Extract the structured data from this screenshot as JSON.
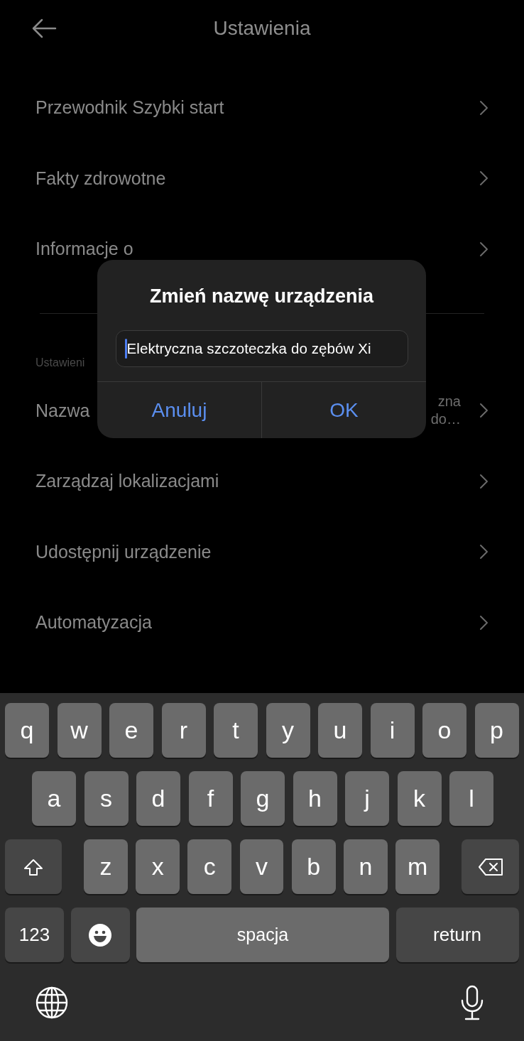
{
  "header": {
    "title": "Ustawienia"
  },
  "sections": [
    {
      "items": [
        {
          "label": "Przewodnik Szybki start"
        },
        {
          "label": "Fakty zdrowotne"
        },
        {
          "label": "Informacje o"
        }
      ]
    },
    {
      "header": "Ustawieni",
      "items": [
        {
          "label": "Nazwa",
          "value_lines": [
            "zna",
            "do…"
          ]
        },
        {
          "label": "Zarządzaj lokalizacjami"
        },
        {
          "label": "Udostępnij urządzenie"
        },
        {
          "label": "Automatyzacja"
        }
      ]
    }
  ],
  "dialog": {
    "title": "Zmień nazwę urządzenia",
    "field": {
      "value": "Elektryczna szczoteczka do zębów Xi",
      "focused": true
    },
    "buttons": [
      "Anuluj",
      "OK"
    ]
  },
  "keyboard": {
    "rows": [
      {
        "keys": [
          {
            "kind": "letter",
            "label": "q"
          },
          {
            "kind": "letter",
            "label": "w"
          },
          {
            "kind": "letter",
            "label": "e"
          },
          {
            "kind": "letter",
            "label": "r"
          },
          {
            "kind": "letter",
            "label": "t"
          },
          {
            "kind": "letter",
            "label": "y"
          },
          {
            "kind": "letter",
            "label": "u"
          },
          {
            "kind": "letter",
            "label": "i"
          },
          {
            "kind": "letter",
            "label": "o"
          },
          {
            "kind": "letter",
            "label": "p"
          }
        ]
      },
      {
        "keys": [
          {
            "kind": "letter",
            "label": "a"
          },
          {
            "kind": "letter",
            "label": "s"
          },
          {
            "kind": "letter",
            "label": "d"
          },
          {
            "kind": "letter",
            "label": "f"
          },
          {
            "kind": "letter",
            "label": "g"
          },
          {
            "kind": "letter",
            "label": "h"
          },
          {
            "kind": "letter",
            "label": "j"
          },
          {
            "kind": "letter",
            "label": "k"
          },
          {
            "kind": "letter",
            "label": "l"
          }
        ]
      },
      {
        "keys": [
          {
            "kind": "shift"
          },
          {
            "kind": "letter",
            "label": "z"
          },
          {
            "kind": "letter",
            "label": "x"
          },
          {
            "kind": "letter",
            "label": "c"
          },
          {
            "kind": "letter",
            "label": "v"
          },
          {
            "kind": "letter",
            "label": "b"
          },
          {
            "kind": "letter",
            "label": "n"
          },
          {
            "kind": "letter",
            "label": "m"
          },
          {
            "kind": "backspace"
          }
        ]
      },
      {
        "keys": [
          {
            "kind": "numbers",
            "label": "123"
          },
          {
            "kind": "emoji"
          },
          {
            "kind": "space",
            "label": "spacja"
          },
          {
            "kind": "return",
            "label": "return"
          }
        ]
      }
    ],
    "bottom": [
      {
        "kind": "globe"
      },
      {
        "kind": "mic"
      }
    ]
  }
}
